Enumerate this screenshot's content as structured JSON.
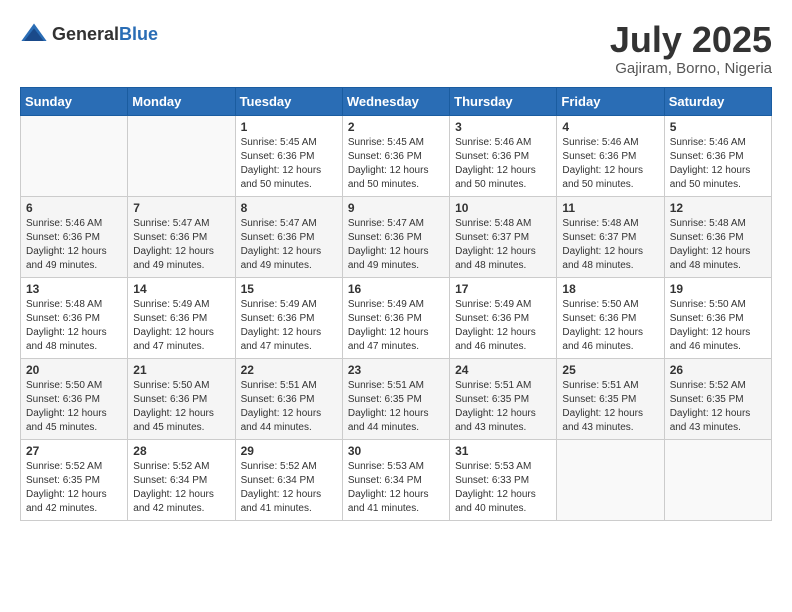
{
  "header": {
    "logo_general": "General",
    "logo_blue": "Blue",
    "month_title": "July 2025",
    "location": "Gajiram, Borno, Nigeria"
  },
  "weekdays": [
    "Sunday",
    "Monday",
    "Tuesday",
    "Wednesday",
    "Thursday",
    "Friday",
    "Saturday"
  ],
  "weeks": [
    [
      {
        "day": "",
        "sunrise": "",
        "sunset": "",
        "daylight": ""
      },
      {
        "day": "",
        "sunrise": "",
        "sunset": "",
        "daylight": ""
      },
      {
        "day": "1",
        "sunrise": "Sunrise: 5:45 AM",
        "sunset": "Sunset: 6:36 PM",
        "daylight": "Daylight: 12 hours and 50 minutes."
      },
      {
        "day": "2",
        "sunrise": "Sunrise: 5:45 AM",
        "sunset": "Sunset: 6:36 PM",
        "daylight": "Daylight: 12 hours and 50 minutes."
      },
      {
        "day": "3",
        "sunrise": "Sunrise: 5:46 AM",
        "sunset": "Sunset: 6:36 PM",
        "daylight": "Daylight: 12 hours and 50 minutes."
      },
      {
        "day": "4",
        "sunrise": "Sunrise: 5:46 AM",
        "sunset": "Sunset: 6:36 PM",
        "daylight": "Daylight: 12 hours and 50 minutes."
      },
      {
        "day": "5",
        "sunrise": "Sunrise: 5:46 AM",
        "sunset": "Sunset: 6:36 PM",
        "daylight": "Daylight: 12 hours and 50 minutes."
      }
    ],
    [
      {
        "day": "6",
        "sunrise": "Sunrise: 5:46 AM",
        "sunset": "Sunset: 6:36 PM",
        "daylight": "Daylight: 12 hours and 49 minutes."
      },
      {
        "day": "7",
        "sunrise": "Sunrise: 5:47 AM",
        "sunset": "Sunset: 6:36 PM",
        "daylight": "Daylight: 12 hours and 49 minutes."
      },
      {
        "day": "8",
        "sunrise": "Sunrise: 5:47 AM",
        "sunset": "Sunset: 6:36 PM",
        "daylight": "Daylight: 12 hours and 49 minutes."
      },
      {
        "day": "9",
        "sunrise": "Sunrise: 5:47 AM",
        "sunset": "Sunset: 6:36 PM",
        "daylight": "Daylight: 12 hours and 49 minutes."
      },
      {
        "day": "10",
        "sunrise": "Sunrise: 5:48 AM",
        "sunset": "Sunset: 6:37 PM",
        "daylight": "Daylight: 12 hours and 48 minutes."
      },
      {
        "day": "11",
        "sunrise": "Sunrise: 5:48 AM",
        "sunset": "Sunset: 6:37 PM",
        "daylight": "Daylight: 12 hours and 48 minutes."
      },
      {
        "day": "12",
        "sunrise": "Sunrise: 5:48 AM",
        "sunset": "Sunset: 6:36 PM",
        "daylight": "Daylight: 12 hours and 48 minutes."
      }
    ],
    [
      {
        "day": "13",
        "sunrise": "Sunrise: 5:48 AM",
        "sunset": "Sunset: 6:36 PM",
        "daylight": "Daylight: 12 hours and 48 minutes."
      },
      {
        "day": "14",
        "sunrise": "Sunrise: 5:49 AM",
        "sunset": "Sunset: 6:36 PM",
        "daylight": "Daylight: 12 hours and 47 minutes."
      },
      {
        "day": "15",
        "sunrise": "Sunrise: 5:49 AM",
        "sunset": "Sunset: 6:36 PM",
        "daylight": "Daylight: 12 hours and 47 minutes."
      },
      {
        "day": "16",
        "sunrise": "Sunrise: 5:49 AM",
        "sunset": "Sunset: 6:36 PM",
        "daylight": "Daylight: 12 hours and 47 minutes."
      },
      {
        "day": "17",
        "sunrise": "Sunrise: 5:49 AM",
        "sunset": "Sunset: 6:36 PM",
        "daylight": "Daylight: 12 hours and 46 minutes."
      },
      {
        "day": "18",
        "sunrise": "Sunrise: 5:50 AM",
        "sunset": "Sunset: 6:36 PM",
        "daylight": "Daylight: 12 hours and 46 minutes."
      },
      {
        "day": "19",
        "sunrise": "Sunrise: 5:50 AM",
        "sunset": "Sunset: 6:36 PM",
        "daylight": "Daylight: 12 hours and 46 minutes."
      }
    ],
    [
      {
        "day": "20",
        "sunrise": "Sunrise: 5:50 AM",
        "sunset": "Sunset: 6:36 PM",
        "daylight": "Daylight: 12 hours and 45 minutes."
      },
      {
        "day": "21",
        "sunrise": "Sunrise: 5:50 AM",
        "sunset": "Sunset: 6:36 PM",
        "daylight": "Daylight: 12 hours and 45 minutes."
      },
      {
        "day": "22",
        "sunrise": "Sunrise: 5:51 AM",
        "sunset": "Sunset: 6:36 PM",
        "daylight": "Daylight: 12 hours and 44 minutes."
      },
      {
        "day": "23",
        "sunrise": "Sunrise: 5:51 AM",
        "sunset": "Sunset: 6:35 PM",
        "daylight": "Daylight: 12 hours and 44 minutes."
      },
      {
        "day": "24",
        "sunrise": "Sunrise: 5:51 AM",
        "sunset": "Sunset: 6:35 PM",
        "daylight": "Daylight: 12 hours and 43 minutes."
      },
      {
        "day": "25",
        "sunrise": "Sunrise: 5:51 AM",
        "sunset": "Sunset: 6:35 PM",
        "daylight": "Daylight: 12 hours and 43 minutes."
      },
      {
        "day": "26",
        "sunrise": "Sunrise: 5:52 AM",
        "sunset": "Sunset: 6:35 PM",
        "daylight": "Daylight: 12 hours and 43 minutes."
      }
    ],
    [
      {
        "day": "27",
        "sunrise": "Sunrise: 5:52 AM",
        "sunset": "Sunset: 6:35 PM",
        "daylight": "Daylight: 12 hours and 42 minutes."
      },
      {
        "day": "28",
        "sunrise": "Sunrise: 5:52 AM",
        "sunset": "Sunset: 6:34 PM",
        "daylight": "Daylight: 12 hours and 42 minutes."
      },
      {
        "day": "29",
        "sunrise": "Sunrise: 5:52 AM",
        "sunset": "Sunset: 6:34 PM",
        "daylight": "Daylight: 12 hours and 41 minutes."
      },
      {
        "day": "30",
        "sunrise": "Sunrise: 5:53 AM",
        "sunset": "Sunset: 6:34 PM",
        "daylight": "Daylight: 12 hours and 41 minutes."
      },
      {
        "day": "31",
        "sunrise": "Sunrise: 5:53 AM",
        "sunset": "Sunset: 6:33 PM",
        "daylight": "Daylight: 12 hours and 40 minutes."
      },
      {
        "day": "",
        "sunrise": "",
        "sunset": "",
        "daylight": ""
      },
      {
        "day": "",
        "sunrise": "",
        "sunset": "",
        "daylight": ""
      }
    ]
  ]
}
